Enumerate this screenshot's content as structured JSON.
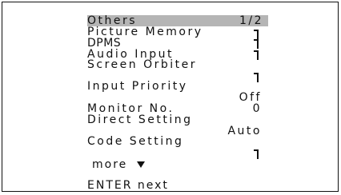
{
  "menu": {
    "title": "Others",
    "page": "1/2",
    "items": [
      {
        "label": "Picture Memory",
        "value": ""
      },
      {
        "label": "DPMS",
        "value": ""
      },
      {
        "label": "Audio Input",
        "value": ""
      },
      {
        "label": "Screen Orbiter",
        "value": ""
      },
      {
        "label": "Input Priority",
        "value": "Off"
      },
      {
        "label": "Monitor No.",
        "value": "0"
      },
      {
        "label": "Direct Setting",
        "value": "Auto"
      },
      {
        "label": "Code Setting",
        "value": ""
      }
    ],
    "more_label": "more",
    "enter_hint": "ENTER next"
  },
  "colors": {
    "highlight": "#b5b5b5",
    "text": "#111111",
    "background": "#ffffff"
  }
}
